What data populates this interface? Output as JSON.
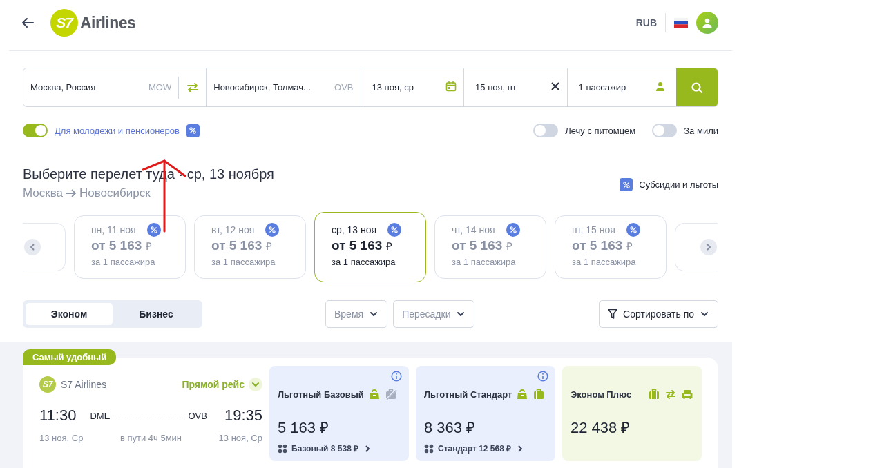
{
  "header": {
    "currency": "RUB",
    "logo_text": "Airlines",
    "logo_mark": "S7"
  },
  "search": {
    "origin": {
      "city": "Москва, Россия",
      "code": "MOW"
    },
    "destination": {
      "city": "Новосибирск, Толмач...",
      "code": "OVB"
    },
    "depart": "13 ноя, ср",
    "return": "15 ноя, пт",
    "passengers": "1 пассажир"
  },
  "toggles": [
    {
      "label": "Для молодежи и пенсионеров",
      "on": true,
      "kind": "discount"
    },
    {
      "label": "Лечу с питомцем",
      "on": false,
      "kind": "plain"
    },
    {
      "label": "За мили",
      "on": false,
      "kind": "plain"
    }
  ],
  "heading": {
    "title": "Выберите перелет туда · ср, 13 ноября",
    "from": "Москва",
    "to": "Новосибирск",
    "subsidies": "Субсидии и льготы"
  },
  "dates": [
    {
      "day": "пн, 11 ноя",
      "price": "от 5 163",
      "currency": "₽",
      "note": "за 1 пассажира",
      "selected": false
    },
    {
      "day": "вт, 12 ноя",
      "price": "от 5 163",
      "currency": "₽",
      "note": "за 1 пассажира",
      "selected": false
    },
    {
      "day": "ср, 13 ноя",
      "price": "от 5 163",
      "currency": "₽",
      "note": "за 1 пассажира",
      "selected": true
    },
    {
      "day": "чт, 14 ноя",
      "price": "от 5 163",
      "currency": "₽",
      "note": "за 1 пассажира",
      "selected": false
    },
    {
      "day": "пт, 15 ноя",
      "price": "от 5 163",
      "currency": "₽",
      "note": "за 1 пассажира",
      "selected": false
    }
  ],
  "cabin_tabs": [
    {
      "label": "Эконом",
      "selected": true
    },
    {
      "label": "Бизнес",
      "selected": false
    }
  ],
  "filters": [
    "Время",
    "Пересадки"
  ],
  "sort": "Сортировать по",
  "flight": {
    "badge": "Самый удобный",
    "airline": "S7 Airlines",
    "airline_mark": "S7",
    "direct": "Прямой рейс",
    "dep_time": "11:30",
    "dep_airport": "DME",
    "arr_airport": "OVB",
    "arr_time": "19:35",
    "dep_date": "13 ноя, Ср",
    "duration": "в пути 4ч 5мин",
    "arr_date": "13 ноя, Ср",
    "fares": [
      {
        "name": "Льготный Базовый",
        "kind": "benefit",
        "info": true,
        "icons": [
          {
            "kind": "bag"
          },
          {
            "kind": "no-luggage"
          }
        ],
        "price": "5 163 ₽",
        "upgrade": "Базовый 8 538 ₽"
      },
      {
        "name": "Льготный Стандарт",
        "kind": "benefit",
        "info": true,
        "icons": [
          {
            "kind": "bag"
          },
          {
            "kind": "luggage"
          }
        ],
        "price": "8 363 ₽",
        "upgrade": "Стандарт 12 568 ₽"
      },
      {
        "name": "Эконом Плюс",
        "kind": "plus",
        "info": false,
        "icons": [
          {
            "kind": "luggage"
          },
          {
            "kind": "exchange"
          },
          {
            "kind": "seat"
          }
        ],
        "price": "22 438 ₽"
      }
    ]
  }
}
